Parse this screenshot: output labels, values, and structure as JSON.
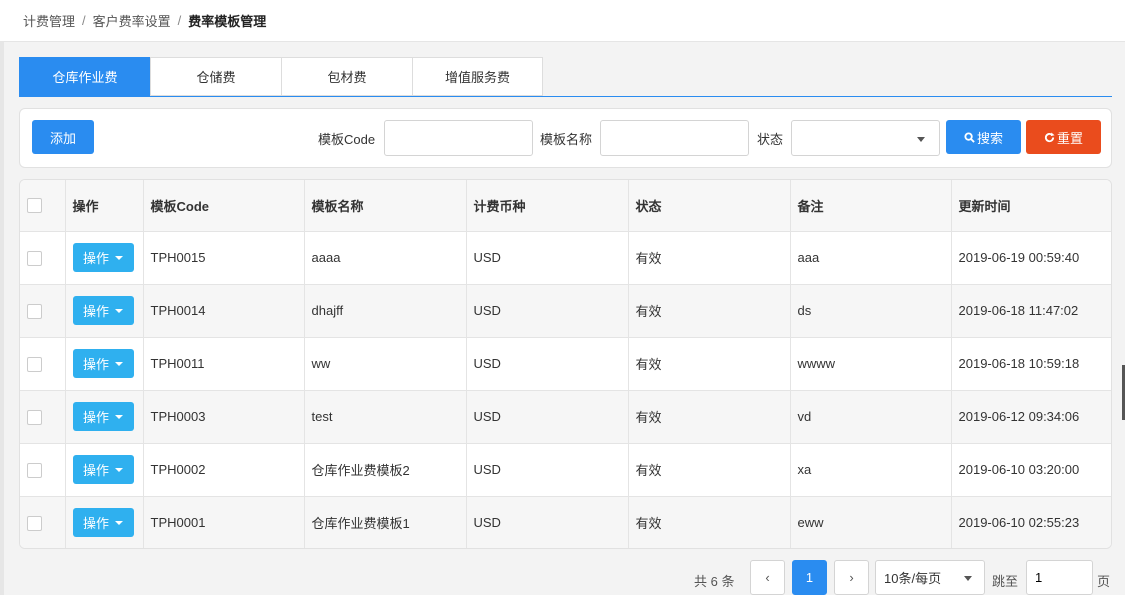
{
  "breadcrumb": {
    "items": [
      "计费管理",
      "客户费率设置",
      "费率模板管理"
    ],
    "separator": "/"
  },
  "tabs": [
    {
      "label": "仓库作业费",
      "active": true
    },
    {
      "label": "仓储费",
      "active": false
    },
    {
      "label": "包材费",
      "active": false
    },
    {
      "label": "增值服务费",
      "active": false
    }
  ],
  "search": {
    "add_label": "添加",
    "code_label": "模板Code",
    "code_value": "",
    "name_label": "模板名称",
    "name_value": "",
    "status_label": "状态",
    "status_value": "",
    "search_label": "搜索",
    "reset_label": "重置"
  },
  "table": {
    "headers": [
      "操作",
      "模板Code",
      "模板名称",
      "计费币种",
      "状态",
      "备注",
      "更新时间"
    ],
    "action_label": "操作",
    "rows": [
      {
        "code": "TPH0015",
        "name": "aaaa",
        "currency": "USD",
        "status": "有效",
        "remark": "aaa",
        "updated": "2019-06-19 00:59:40"
      },
      {
        "code": "TPH0014",
        "name": "dhajff",
        "currency": "USD",
        "status": "有效",
        "remark": "ds",
        "updated": "2019-06-18 11:47:02"
      },
      {
        "code": "TPH0011",
        "name": "ww",
        "currency": "USD",
        "status": "有效",
        "remark": "wwww",
        "updated": "2019-06-18 10:59:18"
      },
      {
        "code": "TPH0003",
        "name": "test",
        "currency": "USD",
        "status": "有效",
        "remark": "vd",
        "updated": "2019-06-12 09:34:06"
      },
      {
        "code": "TPH0002",
        "name": "仓库作业费模板2",
        "currency": "USD",
        "status": "有效",
        "remark": "xa",
        "updated": "2019-06-10 03:20:00"
      },
      {
        "code": "TPH0001",
        "name": "仓库作业费模板1",
        "currency": "USD",
        "status": "有效",
        "remark": "eww",
        "updated": "2019-06-10 02:55:23"
      }
    ]
  },
  "pagination": {
    "total_text": "共 6 条",
    "prev": "‹",
    "current_page": "1",
    "next": "›",
    "page_size": "10条/每页",
    "jump_label": "跳至",
    "jump_value": "1",
    "page_suffix": "页"
  },
  "colors": {
    "primary": "#2a8cf0",
    "action": "#2fb0ef",
    "danger": "#ea4c1d"
  }
}
